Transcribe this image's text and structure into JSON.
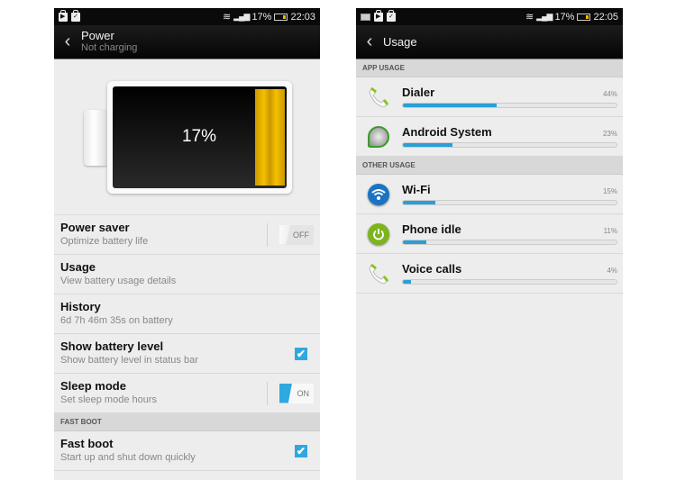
{
  "left": {
    "status": {
      "icons_left": [
        "play-store-icon",
        "store-check-icon"
      ],
      "battery_pct": "17%",
      "time": "22:03"
    },
    "header": {
      "title": "Power",
      "subtitle": "Not charging"
    },
    "battery": {
      "level_label": "17%",
      "level": 0.17,
      "fill_color": "#f5c000"
    },
    "items": [
      {
        "title": "Power saver",
        "subtitle": "Optimize battery life",
        "control": "toggle",
        "state": "OFF"
      },
      {
        "title": "Usage",
        "subtitle": "View battery usage details"
      },
      {
        "title": "History",
        "subtitle": "6d 7h 46m 35s on battery"
      },
      {
        "title": "Show battery level",
        "subtitle": "Show battery level in status bar",
        "control": "checkbox",
        "checked": true
      },
      {
        "title": "Sleep mode",
        "subtitle": "Set sleep mode hours",
        "control": "toggle",
        "state": "ON"
      }
    ],
    "section_fast_boot": "FAST BOOT",
    "fast_boot": {
      "title": "Fast boot",
      "subtitle": "Start up and shut down quickly",
      "checked": true
    },
    "check_glyph": "✔"
  },
  "right": {
    "status": {
      "icons_left": [
        "keyboard-icon",
        "play-store-icon",
        "store-check-icon"
      ],
      "battery_pct": "17%",
      "time": "22:05"
    },
    "header": {
      "title": "Usage"
    },
    "section_app": "APP USAGE",
    "app_usage": [
      {
        "name": "Dialer",
        "pct_label": "44%",
        "pct": 44,
        "icon": "phone-icon"
      },
      {
        "name": "Android System",
        "pct_label": "23%",
        "pct": 23,
        "icon": "android-system-icon"
      }
    ],
    "section_other": "OTHER USAGE",
    "other_usage": [
      {
        "name": "Wi-Fi",
        "pct_label": "15%",
        "pct": 15,
        "icon": "wifi-icon"
      },
      {
        "name": "Phone idle",
        "pct_label": "11%",
        "pct": 11,
        "icon": "power-icon"
      },
      {
        "name": "Voice calls",
        "pct_label": "4%",
        "pct": 4,
        "icon": "phone-icon"
      }
    ],
    "accent": "#2a9fd6"
  },
  "back_glyph": "‹"
}
